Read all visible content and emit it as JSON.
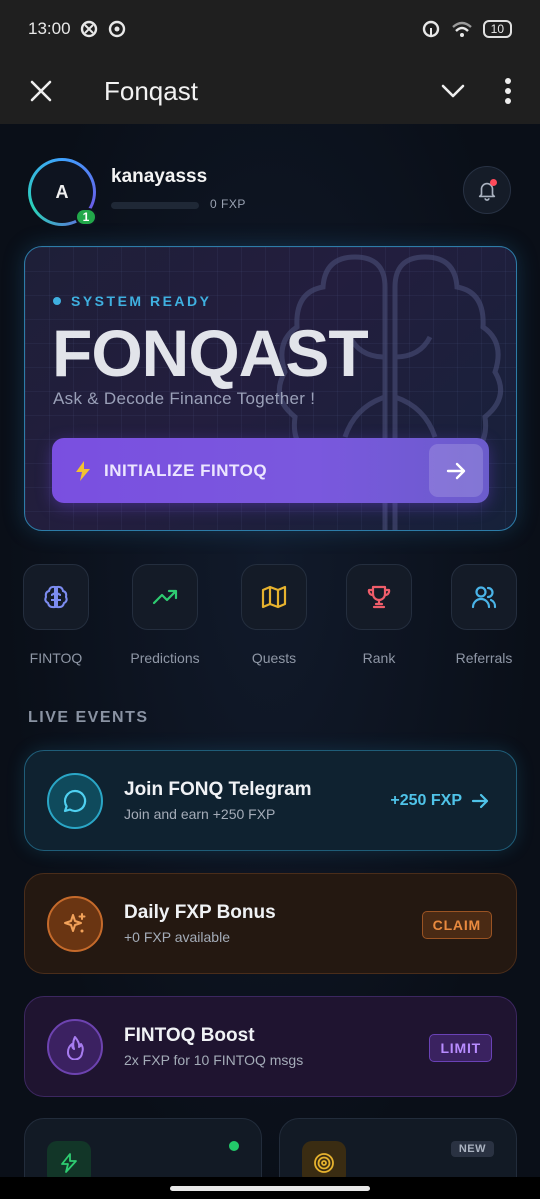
{
  "status": {
    "time": "13:00",
    "battery": "10"
  },
  "appbar": {
    "title": "Fonqast"
  },
  "profile": {
    "avatar_letter": "A",
    "level": "1",
    "username": "kanayasss",
    "xp_text": "0 FXP",
    "xp_progress": 0
  },
  "hero": {
    "status": "SYSTEM READY",
    "title": "FONQAST",
    "subtitle": "Ask & Decode Finance Together !",
    "button_label": "INITIALIZE FINTOQ"
  },
  "quick_actions": [
    {
      "label": "FINTOQ",
      "icon": "brain-icon",
      "color": "#7c8cf0"
    },
    {
      "label": "Predictions",
      "icon": "trending-up-icon",
      "color": "#2ecc71"
    },
    {
      "label": "Quests",
      "icon": "map-icon",
      "color": "#e6b22e"
    },
    {
      "label": "Rank",
      "icon": "trophy-icon",
      "color": "#ef5d6a"
    },
    {
      "label": "Referrals",
      "icon": "users-icon",
      "color": "#4ab4e8"
    }
  ],
  "events": {
    "section_title": "LIVE EVENTS",
    "telegram": {
      "title": "Join FONQ Telegram",
      "subtitle": "Join and earn +250 FXP",
      "reward": "+250 FXP"
    },
    "daily": {
      "title": "Daily FXP Bonus",
      "subtitle": "+0 FXP available",
      "action": "CLAIM"
    },
    "boost": {
      "title": "FINTOQ Boost",
      "subtitle": "2x FXP for 10 FINTOQ msgs",
      "action": "LIMIT"
    }
  },
  "bottom_cards": {
    "right_badge": "NEW"
  },
  "colors": {
    "accent_purple": "#7a4fe0",
    "accent_cyan": "#3fb0e0",
    "claim_orange": "#e98a3f",
    "limit_purple": "#b88cff",
    "online_green": "#23c96a"
  }
}
